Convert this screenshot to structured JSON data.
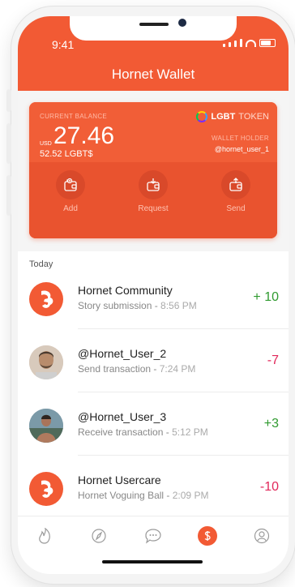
{
  "status": {
    "time": "9:41"
  },
  "header": {
    "title": "Hornet Wallet"
  },
  "balance": {
    "current_label": "CURRENT BALANCE",
    "currency": "USD",
    "amount": "27.46",
    "token_amount": "52.52 LGBT$",
    "token_brand": "LGBT",
    "token_word": "TOKEN",
    "holder_label": "WALLET HOLDER",
    "holder": "@hornet_user_1"
  },
  "actions": [
    {
      "label": "Add",
      "icon": "wallet-add-icon"
    },
    {
      "label": "Request",
      "icon": "wallet-request-icon"
    },
    {
      "label": "Send",
      "icon": "wallet-send-icon"
    }
  ],
  "list": {
    "section_label": "Today",
    "items": [
      {
        "name": "Hornet Community",
        "desc": "Story submission",
        "time": "8:56 PM",
        "amount": "+ 10",
        "kind": "pos"
      },
      {
        "name": "@Hornet_User_2",
        "desc": "Send transaction",
        "time": "7:24 PM",
        "amount": "-7",
        "kind": "neg"
      },
      {
        "name": "@Hornet_User_3",
        "desc": "Receive transaction",
        "time": "5:12 PM",
        "amount": "+3",
        "kind": "pos"
      },
      {
        "name": "Hornet Usercare",
        "desc": "Hornet Voguing Ball",
        "time": "2:09 PM",
        "amount": "-10",
        "kind": "neg"
      }
    ]
  },
  "tabbar": {
    "tabs": [
      "flame-icon",
      "compass-icon",
      "chat-bubble-icon",
      "dollar-icon",
      "profile-icon"
    ],
    "active": "dollar-icon",
    "accent": "#f25a34"
  }
}
